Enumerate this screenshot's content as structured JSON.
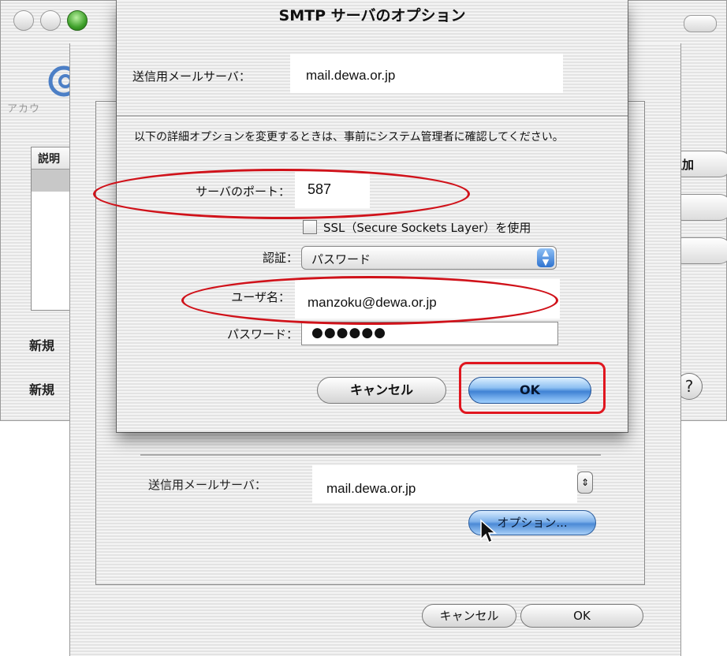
{
  "dialog": {
    "title": "SMTP サーバのオプション",
    "server_label": "送信用メールサーバ：",
    "server_value": "mail.dewa.or.jp",
    "note": "以下の詳細オプションを変更するときは、事前にシステム管理者に確認してください。",
    "port_label": "サーバのポート：",
    "port_value": "587",
    "ssl_label": "SSL（Secure Sockets Layer）を使用",
    "auth_label": "認証：",
    "auth_value": "パスワード",
    "username_label": "ユーザ名：",
    "username_value": "manzoku@dewa.or.jp",
    "password_label": "パスワード：",
    "password_value": "●●●●●●",
    "cancel_label": "キャンセル",
    "ok_label": "OK"
  },
  "background_window": {
    "account_label": "アカウ",
    "list_header": "説明",
    "new_label_1": "新規",
    "new_label_2": "新規",
    "add_button": "追加",
    "help_glyph": "?"
  },
  "middle_sheet": {
    "server_label": "送信用メールサーバ：",
    "server_value": "mail.dewa.or.jp",
    "options_button": "オプション...",
    "cancel_label": "キャンセル",
    "ok_label": "OK"
  },
  "colors": {
    "annotation_red": "#d0121a",
    "button_blue": "#3f82d4"
  }
}
